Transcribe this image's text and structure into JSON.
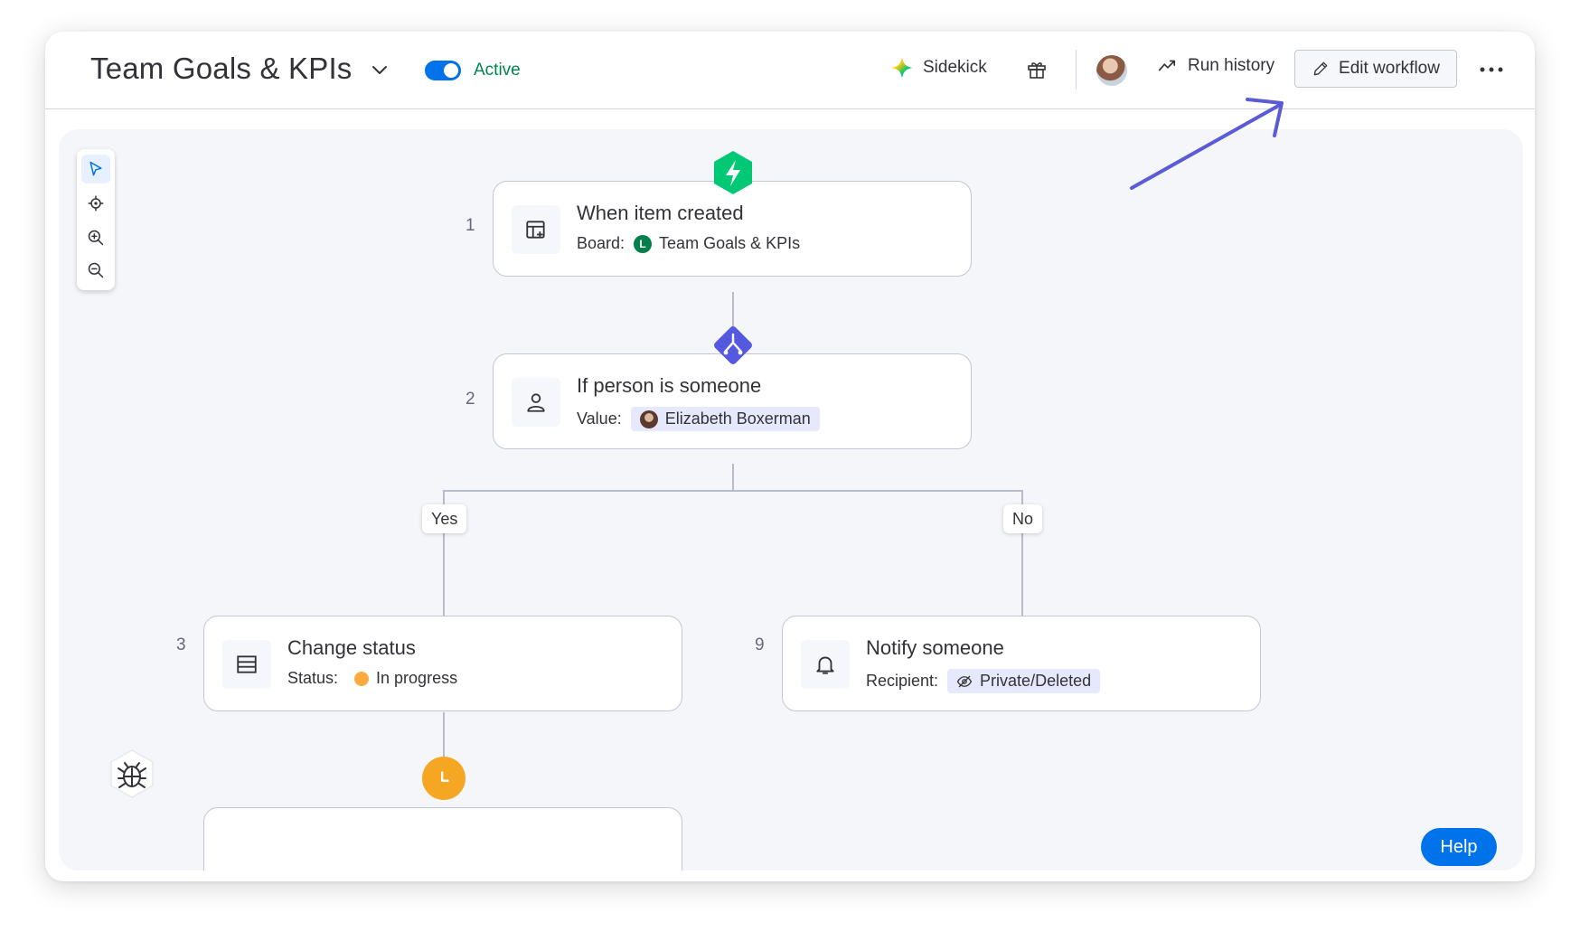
{
  "header": {
    "title": "Team Goals & KPIs",
    "status_label": "Active",
    "sidekick_label": "Sidekick",
    "run_history_label": "Run history",
    "edit_workflow_label": "Edit workflow"
  },
  "workflow": {
    "steps": [
      {
        "number": "1",
        "title": "When item created",
        "sub_label": "Board:",
        "value": "Team Goals & KPIs",
        "value_badge": "L"
      },
      {
        "number": "2",
        "title": "If person is someone",
        "sub_label": "Value:",
        "value": "Elizabeth Boxerman"
      },
      {
        "number": "3",
        "title": "Change status",
        "sub_label": "Status:",
        "value": "In progress"
      },
      {
        "number": "9",
        "title": "Notify someone",
        "sub_label": "Recipient:",
        "value": "Private/Deleted"
      }
    ],
    "branch_yes": "Yes",
    "branch_no": "No"
  },
  "help_label": "Help",
  "colors": {
    "accent": "#0073ea",
    "active_green": "#00854d",
    "trigger_green": "#00c875",
    "condition_purple": "#5559df",
    "wait_orange": "#f5a623",
    "status_orange": "#fdab3d",
    "annotation_arrow": "#5b5bd6"
  },
  "icons": [
    "chevron-down-icon",
    "sparkle-icon",
    "gift-icon",
    "trend-icon",
    "pencil-icon",
    "more-icon",
    "cursor-icon",
    "locate-icon",
    "zoom-in-icon",
    "zoom-out-icon",
    "lightning-icon",
    "branch-icon",
    "board-add-icon",
    "person-icon",
    "status-list-icon",
    "bell-icon",
    "eye-off-icon",
    "clock-icon",
    "bug-icon"
  ]
}
